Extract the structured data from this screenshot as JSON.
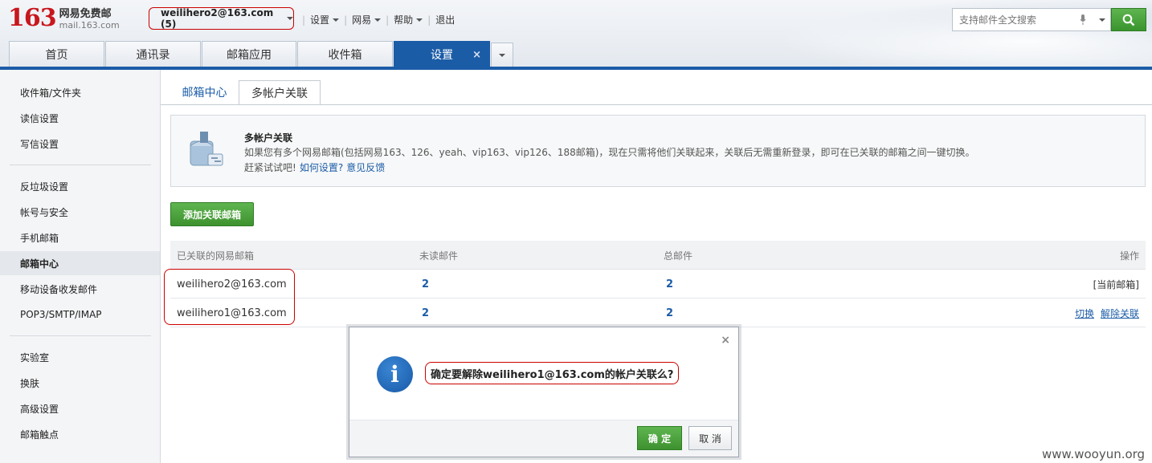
{
  "header": {
    "logo_number": "163",
    "logo_cn": "网易免费邮",
    "logo_en": "mail.163.com",
    "account": "weilihero2@163.com (5)",
    "links": [
      "设置",
      "网易",
      "帮助"
    ],
    "logout": "退出",
    "search_placeholder": "支持邮件全文搜索"
  },
  "nav_tabs": [
    {
      "label": "首页"
    },
    {
      "label": "通讯录"
    },
    {
      "label": "邮箱应用"
    },
    {
      "label": "收件箱"
    },
    {
      "label": "设置",
      "close": "×"
    }
  ],
  "sidebar": {
    "items": [
      "收件箱/文件夹",
      "读信设置",
      "写信设置",
      "反垃圾设置",
      "帐号与安全",
      "手机邮箱",
      "邮箱中心",
      "移动设备收发邮件",
      "POP3/SMTP/IMAP",
      "实验室",
      "换肤",
      "高级设置",
      "邮箱触点"
    ],
    "active": "邮箱中心"
  },
  "subtabs": {
    "center": "邮箱中心",
    "multi": "多帐户关联"
  },
  "info": {
    "title": "多帐户关联",
    "desc": "如果您有多个网易邮箱(包括网易163、126、yeah、vip163、vip126、188邮箱)，现在只需将他们关联起来，关联后无需重新登录，即可在已关联的邮箱之间一键切换。",
    "try": "赶紧试试吧!",
    "how": "如何设置?",
    "feedback": "意见反馈"
  },
  "add_button": "添加关联邮箱",
  "table": {
    "headers": [
      "已关联的网易邮箱",
      "未读邮件",
      "总邮件",
      "操作"
    ],
    "rows": [
      {
        "email": "weilihero2@163.com",
        "unread": "2",
        "total": "2",
        "op_current": "[当前邮箱]"
      },
      {
        "email": "weilihero1@163.com",
        "unread": "2",
        "total": "2",
        "op_switch": "切换",
        "op_unlink": "解除关联"
      }
    ]
  },
  "dialog": {
    "close": "×",
    "icon": "i",
    "message": "确定要解除weilihero1@163.com的帐户关联么?",
    "ok": "确 定",
    "cancel": "取 消"
  },
  "watermark": "www.wooyun.org",
  "colors": {
    "brand_red": "#c8161d",
    "nav_blue": "#1b5ca7",
    "ok_green": "#4aa33c"
  }
}
